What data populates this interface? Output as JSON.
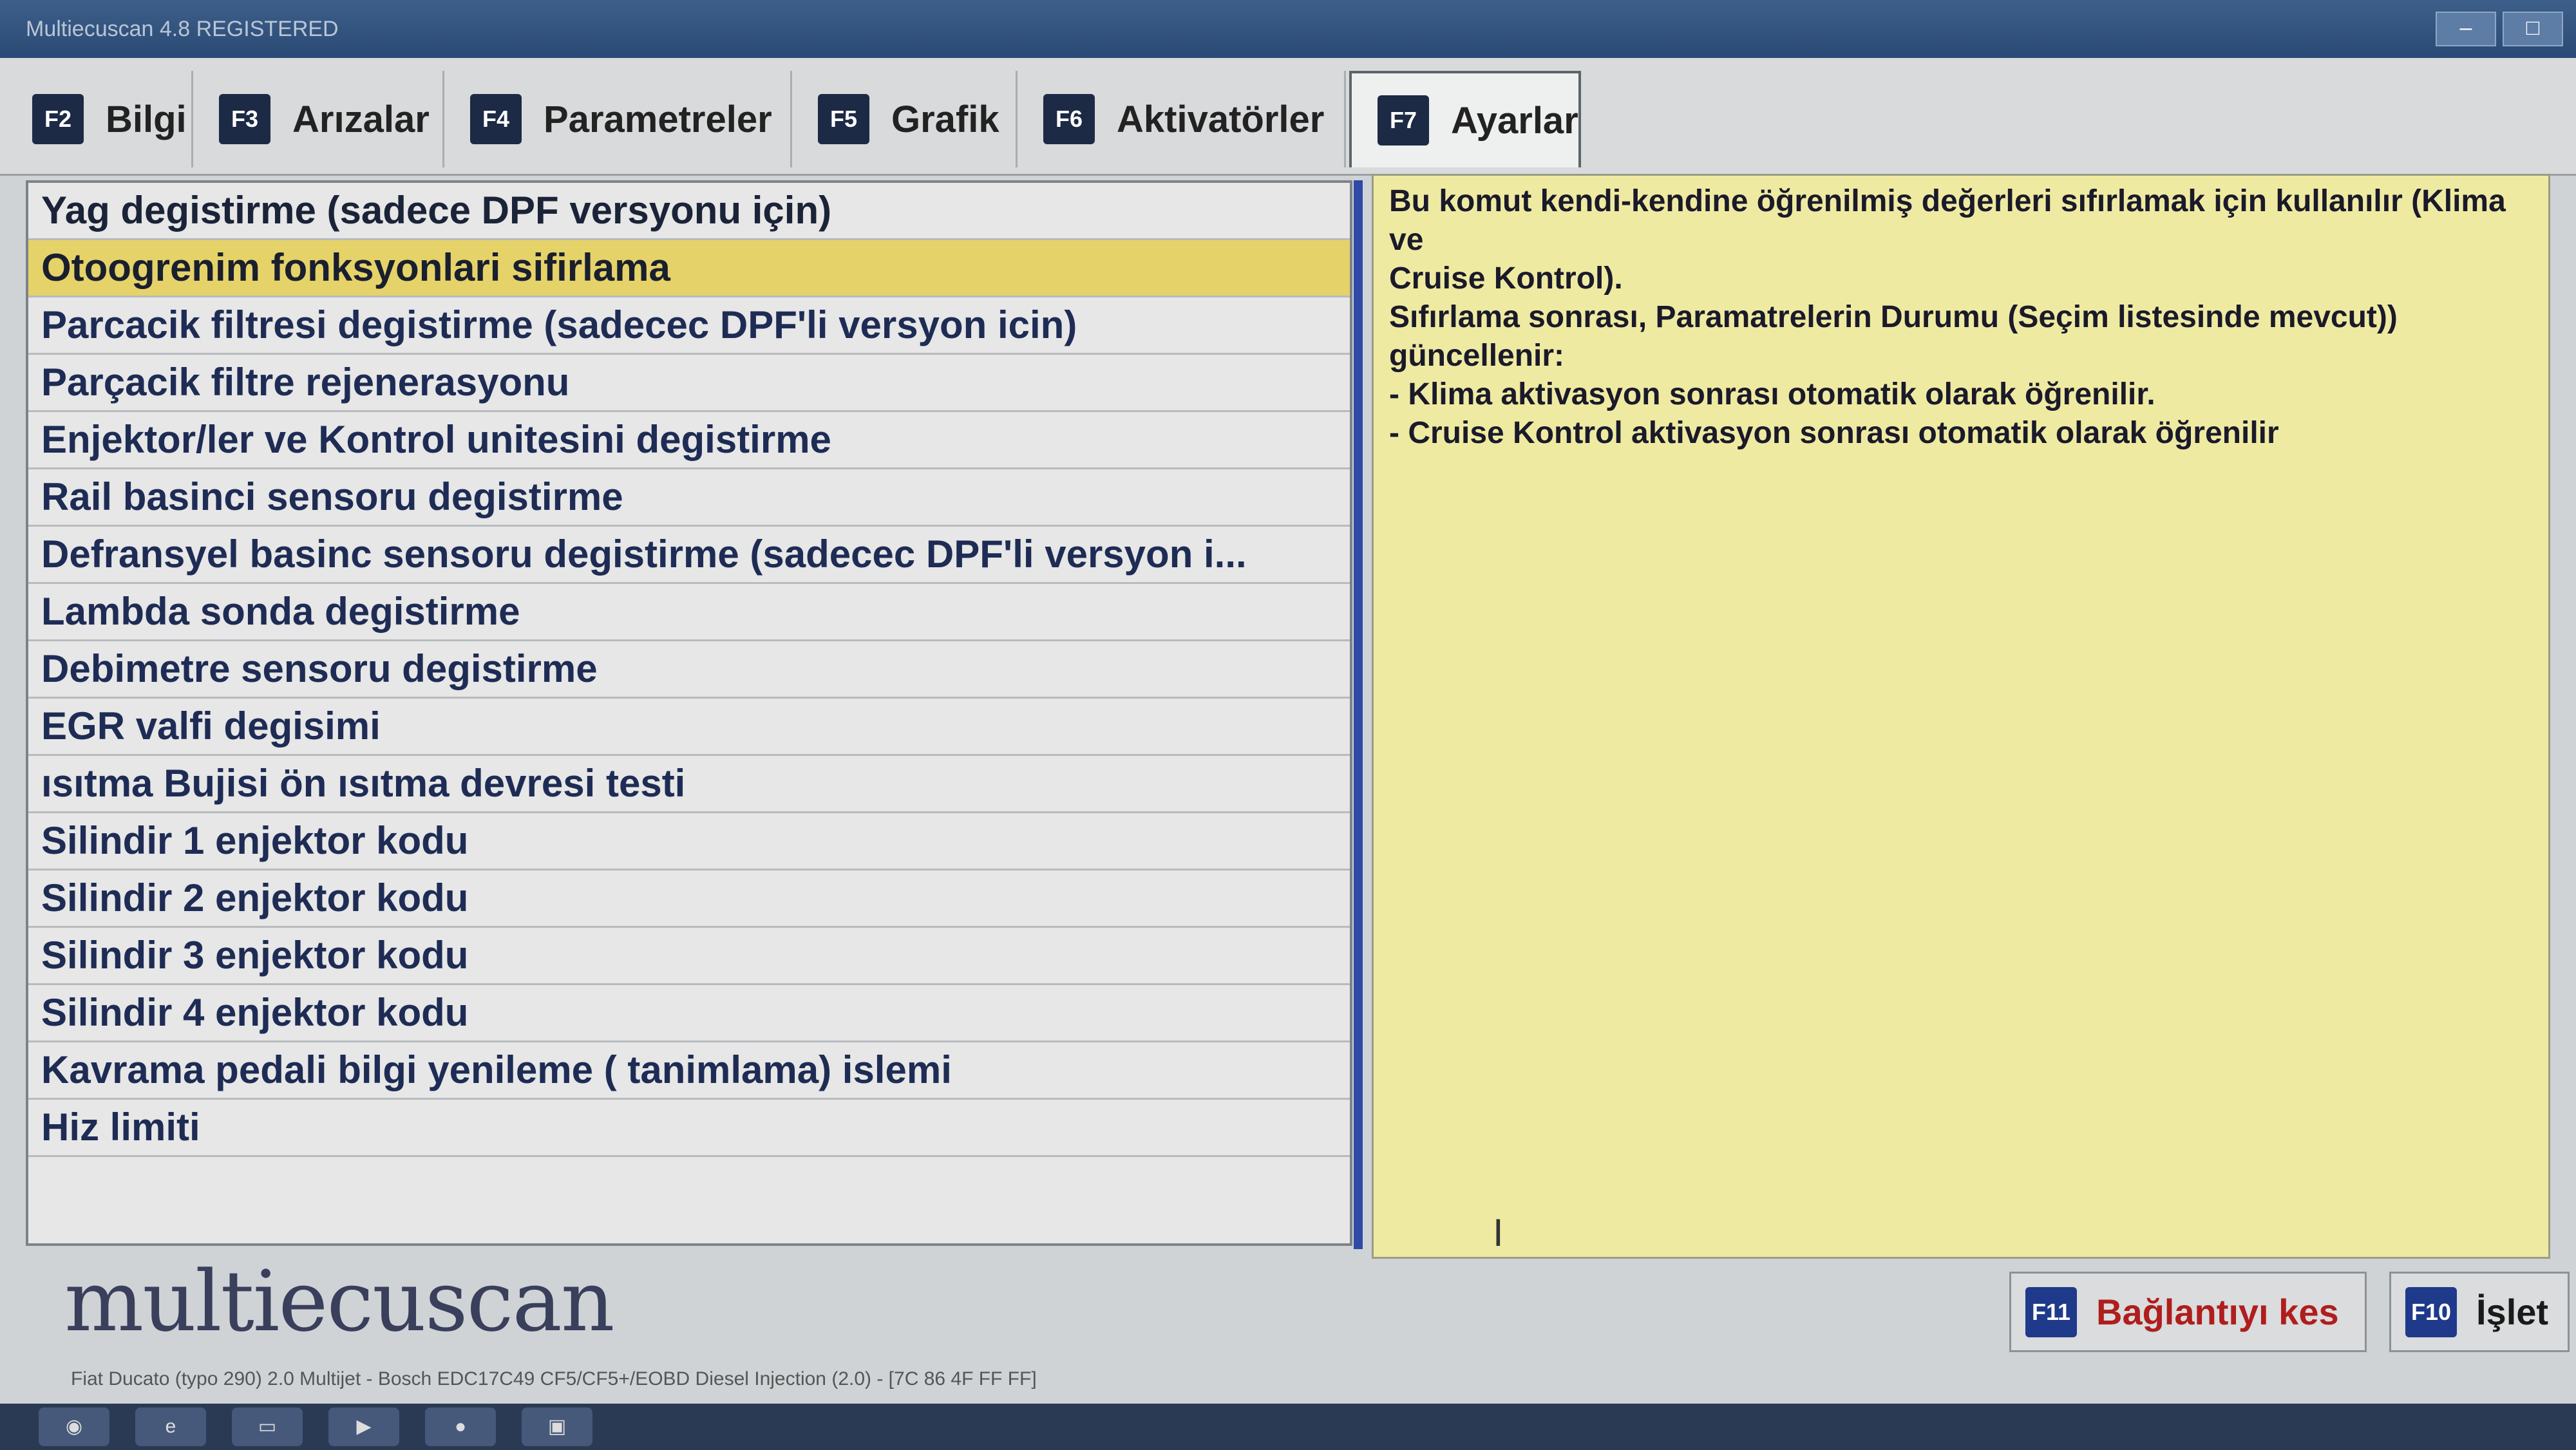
{
  "window": {
    "title": "Multiecuscan 4.8 REGISTERED"
  },
  "tabs": [
    {
      "key": "F2",
      "label": "Bilgi"
    },
    {
      "key": "F3",
      "label": "Arızalar"
    },
    {
      "key": "F4",
      "label": "Parametreler"
    },
    {
      "key": "F5",
      "label": "Grafik"
    },
    {
      "key": "F6",
      "label": "Aktivatörler"
    },
    {
      "key": "F7",
      "label": "Ayarlar"
    }
  ],
  "functions": {
    "selected_index": 1,
    "items": [
      "Yag degistirme (sadece DPF versyonu için)",
      "Otoogrenim fonksyonlari sifirlama",
      "Parcacik filtresi degistirme (sadecec DPF'li versyon icin)",
      "Parçacik filtre rejenerasyonu",
      "Enjektor/ler ve Kontrol unitesini degistirme",
      "Rail basinci sensoru degistirme",
      "Defransyel basinc sensoru degistirme (sadecec DPF'li versyon i...",
      "Lambda sonda degistirme",
      "Debimetre sensoru degistirme",
      "EGR valfi degisimi",
      "ısıtma Bujisi ön ısıtma devresi testi",
      "Silindir 1 enjektor kodu",
      "Silindir 2 enjektor kodu",
      "Silindir 3 enjektor kodu",
      "Silindir 4 enjektor kodu",
      "Kavrama pedali  bilgi yenileme ( tanimlama) islemi",
      "Hiz limiti"
    ]
  },
  "description": {
    "line1": "Bu komut kendi-kendine öğrenilmiş değerleri sıfırlamak için kullanılır (Klima ve",
    "line2": "Cruise Kontrol).",
    "line3": "Sıfırlama sonrası, Paramatrelerin Durumu (Seçim listesinde mevcut))",
    "line4": "güncellenir:",
    "line5": "- Klima aktivasyon sonrası otomatik olarak öğrenilir.",
    "line6": "- Cruise Kontrol aktivasyon sonrası otomatik olarak öğrenilir"
  },
  "footer": {
    "logo": "multiecuscan",
    "status": "Fiat Ducato (typo 290) 2.0 Multijet - Bosch EDC17C49 CF5/CF5+/EOBD Diesel Injection (2.0) - [7C 86 4F FF FF]"
  },
  "buttons": {
    "disconnect": {
      "key": "F11",
      "label": "Bağlantıyı kes"
    },
    "execute": {
      "key": "F10",
      "label": "İşlet"
    }
  },
  "taskbar": {
    "icons": [
      "start-icon",
      "ie-icon",
      "folder-icon",
      "media-icon",
      "blz-icon",
      "app-icon"
    ]
  }
}
